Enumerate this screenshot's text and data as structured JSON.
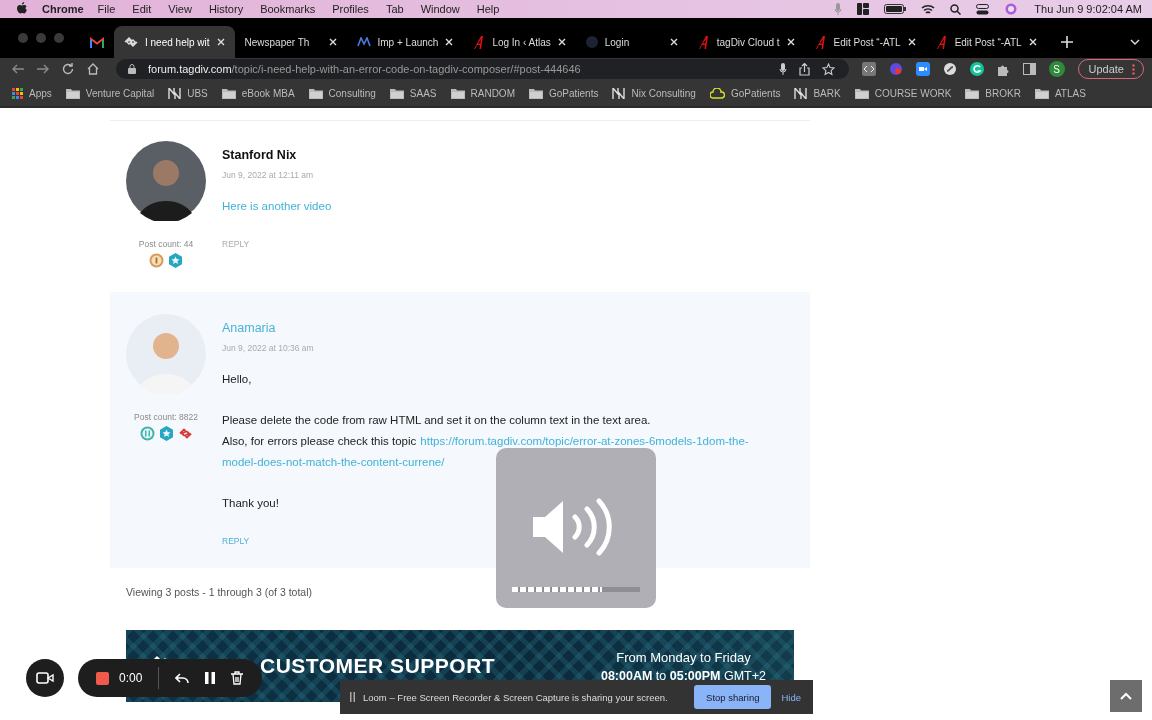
{
  "menu_bar": {
    "app": "Chrome",
    "items": [
      "File",
      "Edit",
      "View",
      "History",
      "Bookmarks",
      "Profiles",
      "Tab",
      "Window",
      "Help"
    ],
    "clock": "Thu Jun 9  9:02:04 AM"
  },
  "tabs": [
    {
      "title": "I need help wit",
      "kind": "tagdiv",
      "selected": true
    },
    {
      "title": "Newspaper Th",
      "kind": "plain",
      "selected": false
    },
    {
      "title": "Imp + Launch",
      "kind": "launch",
      "selected": false
    },
    {
      "title": "Log In ‹ Atlas",
      "kind": "atlas",
      "selected": false
    },
    {
      "title": "Login",
      "kind": "circle",
      "selected": false
    },
    {
      "title": "tagDiv Cloud t",
      "kind": "atlas",
      "selected": false
    },
    {
      "title": "Edit Post “-ATL",
      "kind": "atlas",
      "selected": false
    },
    {
      "title": "Edit Post “-ATL",
      "kind": "atlas",
      "selected": false
    }
  ],
  "address": {
    "host": "forum.tagdiv.com",
    "path": "/topic/i-need-help-with-an-error-code-on-tagdiv-composer/#post-444646"
  },
  "profile": "S",
  "update_button": "Update",
  "bookmarks": [
    {
      "label": "Apps",
      "kind": "apps"
    },
    {
      "label": "Venture Capital",
      "kind": "folder"
    },
    {
      "label": "UBS",
      "kind": "logo"
    },
    {
      "label": "eBook MBA",
      "kind": "folder"
    },
    {
      "label": "Consulting",
      "kind": "folder"
    },
    {
      "label": "SAAS",
      "kind": "folder"
    },
    {
      "label": "RANDOM",
      "kind": "folder"
    },
    {
      "label": "GoPatients",
      "kind": "folder"
    },
    {
      "label": "Nix Consulting",
      "kind": "logo"
    },
    {
      "label": "GoPatients",
      "kind": "cloud"
    },
    {
      "label": "BARK",
      "kind": "logo"
    },
    {
      "label": "COURSE WORK",
      "kind": "folder"
    },
    {
      "label": "BROKR",
      "kind": "folder"
    },
    {
      "label": "ATLAS",
      "kind": "folder"
    }
  ],
  "posts": [
    {
      "author": "Stanford Nix",
      "author_link": false,
      "highlighted": false,
      "date": "Jun 9, 2022 at 12:11 am",
      "post_count": "Post count: 44",
      "badges": [
        {
          "kind": "bronze"
        },
        {
          "kind": "star"
        }
      ],
      "body": [
        {
          "lines": [
            [
              {
                "text": "Here is another video",
                "link": true
              }
            ]
          ]
        }
      ],
      "reply": "REPLY"
    },
    {
      "author": "Anamaria",
      "author_link": true,
      "highlighted": true,
      "date": "Jun 9, 2022 at 10:36 am",
      "post_count": "Post count: 8822",
      "badges": [
        {
          "kind": "silver"
        },
        {
          "kind": "star"
        },
        {
          "kind": "chain"
        }
      ],
      "body": [
        {
          "lines": [
            [
              {
                "text": "Hello,",
                "link": false
              }
            ]
          ]
        },
        {
          "lines": [
            [
              {
                "text": "Please delete the code from raw HTML and set it on the column text in the text area.",
                "link": false
              }
            ],
            [
              {
                "text": "Also, for errors please check this topic",
                "link": false
              },
              {
                "text": "https://forum.tagdiv.com/topic/error-at-zones-6models-1dom-the-",
                "link": true
              }
            ],
            [
              {
                "text": "model-does-not-match-the-content-currene/",
                "link": true
              }
            ]
          ]
        },
        {
          "lines": [
            [
              {
                "text": "Thank you!",
                "link": false
              }
            ]
          ]
        }
      ],
      "reply": "REPLY"
    }
  ],
  "viewing": "Viewing 3 posts - 1 through 3 (of 3 total)",
  "banner": {
    "title": "CUSTOMER SUPPORT",
    "days": "From Monday to Friday",
    "hours": "**08:00AM** to **05:00PM** GMT+2"
  },
  "volume_hud": {
    "level": 0.7
  },
  "recorder": {
    "timer": "0:00"
  },
  "share_bar": {
    "message": "Loom – Free Screen Recorder & Screen Capture is sharing your screen.",
    "stop": "Stop sharing",
    "hide": "Hide"
  }
}
